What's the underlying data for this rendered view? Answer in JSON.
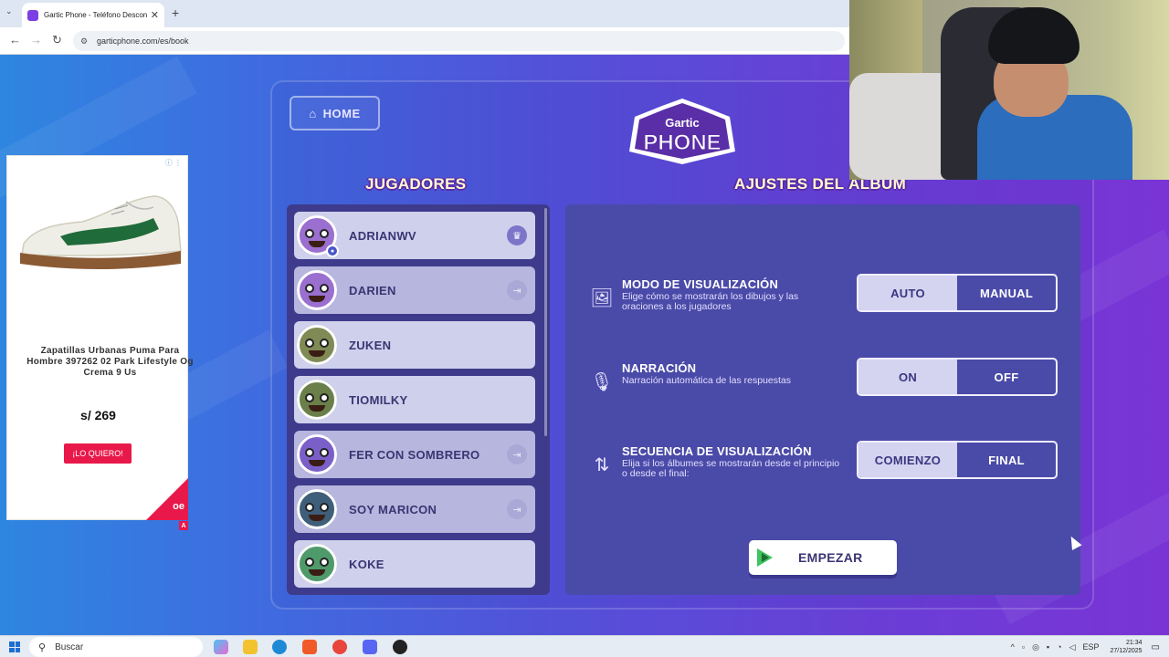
{
  "browser": {
    "tab_title": "Gartic Phone - Teléfono Descon",
    "new_tab": "+",
    "close_tab": "✕",
    "url": "garticphone.com/es/book"
  },
  "ad": {
    "product_name": "Zapatillas Urbanas Puma Para Hombre 397262 02 Park Lifestyle Og Crema 9 Us",
    "price": "s/ 269",
    "button": "¡LO QUIERO!",
    "badge": "A",
    "brand_mark": "oe"
  },
  "game": {
    "home_label": "HOME",
    "logo_line1": "Gartic",
    "logo_line2": "PHONE",
    "players_title": "JUGADORES",
    "settings_title": "AJUSTES DEL ÁLBUM",
    "players": [
      {
        "name": "ADRIANWV",
        "icon": "crown-icon"
      },
      {
        "name": "DARIEN",
        "icon": "kick-icon"
      },
      {
        "name": "ZUKEN",
        "icon": ""
      },
      {
        "name": "TIOMILKY",
        "icon": ""
      },
      {
        "name": "FER CON SOMBRERO",
        "icon": "kick-icon"
      },
      {
        "name": "SOY MARICON",
        "icon": "kick-icon"
      },
      {
        "name": "KOKE",
        "icon": ""
      }
    ],
    "settings": [
      {
        "title": "MODO DE VISUALIZACIÓN",
        "desc": "Elige cómo se mostrarán los dibujos y las oraciones a los jugadores",
        "icon": "image-icon",
        "options": [
          "AUTO",
          "MANUAL"
        ],
        "selected": "AUTO"
      },
      {
        "title": "NARRACIÓN",
        "desc": "Narración automática de las respuestas",
        "icon": "microphone-icon",
        "options": [
          "ON",
          "OFF"
        ],
        "selected": "ON"
      },
      {
        "title": "SECUENCIA DE VISUALIZACIÓN",
        "desc": "Elija si los álbumes se mostrarán desde el principio o desde el final:",
        "icon": "sort-arrows-icon",
        "options": [
          "COMIENZO",
          "FINAL"
        ],
        "selected": "COMIENZO"
      }
    ],
    "start_label": "EMPEZAR"
  },
  "taskbar": {
    "search_placeholder": "Buscar",
    "lang": "ESP",
    "time": "21:34",
    "date": "27/12/2025"
  },
  "colors": {
    "accent_green": "#3fc460",
    "ad_red": "#e8184a",
    "panel": "#4a4aa8"
  }
}
